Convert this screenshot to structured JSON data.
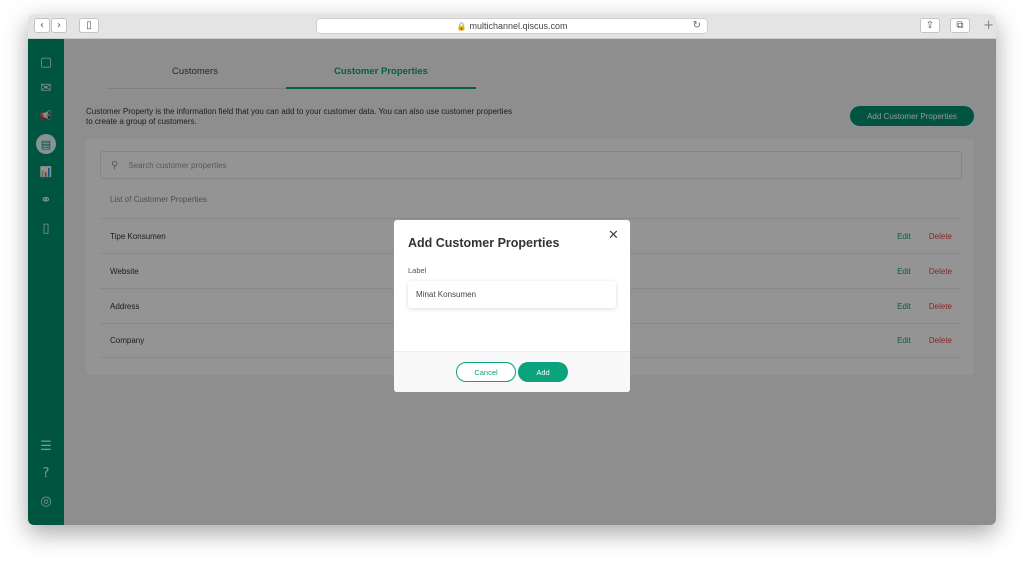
{
  "browser": {
    "url": "multichannel.qiscus.com",
    "back_glyph": "‹",
    "forward_glyph": "›",
    "sidebar_glyph": "▯",
    "share_glyph": "⇪",
    "tabs_glyph": "⧉",
    "reload_glyph": "↻",
    "lock_glyph": "🔒",
    "new_tab_glyph": "+"
  },
  "sidebar": {
    "top_items": [
      {
        "icon": "chat-bubble-icon",
        "glyph": "▢"
      },
      {
        "icon": "mail-icon",
        "glyph": "✉"
      },
      {
        "icon": "megaphone-icon",
        "glyph": "📢"
      },
      {
        "icon": "customer-card-icon",
        "glyph": "▤",
        "active": true
      },
      {
        "icon": "analytics-icon",
        "glyph": "📊"
      },
      {
        "icon": "integration-icon",
        "glyph": "⚭"
      },
      {
        "icon": "mobile-icon",
        "glyph": "▯"
      }
    ],
    "bottom_items": [
      {
        "icon": "settings-sliders-icon",
        "glyph": "☰"
      },
      {
        "icon": "help-icon",
        "glyph": "?"
      },
      {
        "icon": "target-icon",
        "glyph": "◎"
      }
    ]
  },
  "tabs": {
    "customers": "Customers",
    "properties": "Customer Properties"
  },
  "description": "Customer Property is the information field that you can add to your customer data. You can also use customer properties to create a group of customers.",
  "add_button": "Add Customer Properties",
  "search": {
    "placeholder": "Search customer properties",
    "icon_glyph": "⚲"
  },
  "list_title": "List of Customer Properties",
  "rows": [
    {
      "name": "Tipe Konsumen",
      "edit": "Edit",
      "delete": "Delete"
    },
    {
      "name": "Website",
      "edit": "Edit",
      "delete": "Delete"
    },
    {
      "name": "Address",
      "edit": "Edit",
      "delete": "Delete"
    },
    {
      "name": "Company",
      "edit": "Edit",
      "delete": "Delete"
    }
  ],
  "modal": {
    "title": "Add Customer Properties",
    "close_glyph": "✕",
    "label": "Label",
    "input_value": "Minat Konsumen",
    "cancel": "Cancel",
    "add": "Add"
  },
  "colors": {
    "brand": "#01936f",
    "accent": "#0aa37e",
    "danger": "#e04848"
  }
}
